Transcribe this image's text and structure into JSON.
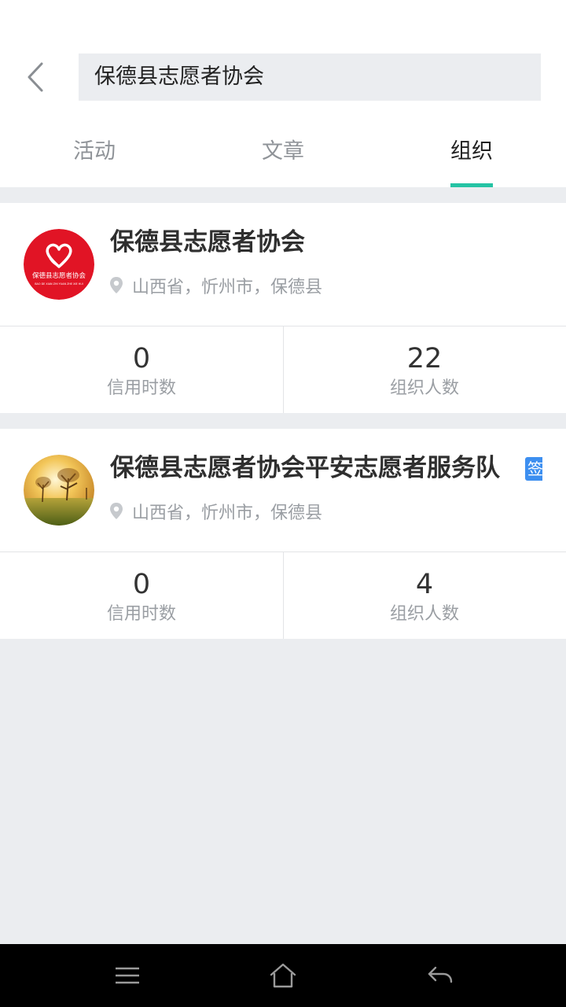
{
  "search": {
    "value": "保德县志愿者协会"
  },
  "tabs": [
    {
      "label": "活动",
      "active": false
    },
    {
      "label": "文章",
      "active": false
    },
    {
      "label": "组织",
      "active": true
    }
  ],
  "colors": {
    "accent": "#25c3a4",
    "badge": "#3d8ff0",
    "logo_red": "#e11425"
  },
  "orgs": [
    {
      "name": "保德县志愿者协会",
      "logo_text": "保德县志愿者协会",
      "logo_subtext": "BAO DE XIAN ZHI YUAN ZHE XIE HUI",
      "location": "山西省，忻州市，保德县",
      "credit_hours": "0",
      "credit_hours_label": "信用时数",
      "members": "22",
      "members_label": "组织人数"
    },
    {
      "name": "保德县志愿者协会平安志愿者服务队",
      "badge": "签",
      "location": "山西省，忻州市，保德县",
      "credit_hours": "0",
      "credit_hours_label": "信用时数",
      "members": "4",
      "members_label": "组织人数"
    }
  ],
  "icons": {
    "back": "chevron-left-icon",
    "location": "location-pin-icon",
    "menu": "menu-icon",
    "home": "home-icon",
    "return": "back-arrow-icon"
  }
}
